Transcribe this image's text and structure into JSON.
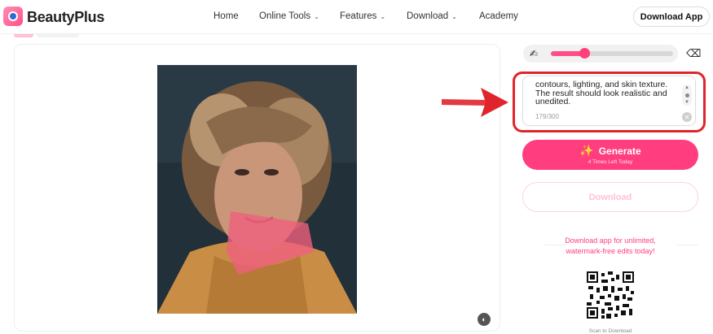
{
  "header": {
    "brand": "BeautyPlus",
    "nav": [
      {
        "label": "Home"
      },
      {
        "label": "Online Tools"
      },
      {
        "label": "Features"
      },
      {
        "label": "Download"
      },
      {
        "label": "Academy"
      }
    ],
    "download_app": "Download App"
  },
  "icons": {
    "logo": "beautyplus-logo-icon",
    "brush": "brush-size-icon",
    "eraser": "eraser-icon",
    "compare": "compare-icon",
    "generate": "sparkle-icon",
    "clear": "clear-icon"
  },
  "brush": {
    "size_fraction": 0.27
  },
  "prompt": {
    "value": "contours, lighting, and skin texture. The result should look realistic and unedited.",
    "counter": "179/300"
  },
  "generate": {
    "label": "Generate",
    "sublabel": "4 Times Left Today"
  },
  "download": {
    "label": "Download"
  },
  "promo": {
    "line1": "Download app for unlimited,",
    "line2": "watermark-free edits today!",
    "scan": "Scan to Download"
  },
  "colors": {
    "accent": "#ff3d7f",
    "highlight": "#e0242b",
    "mask": "#f0607e"
  }
}
